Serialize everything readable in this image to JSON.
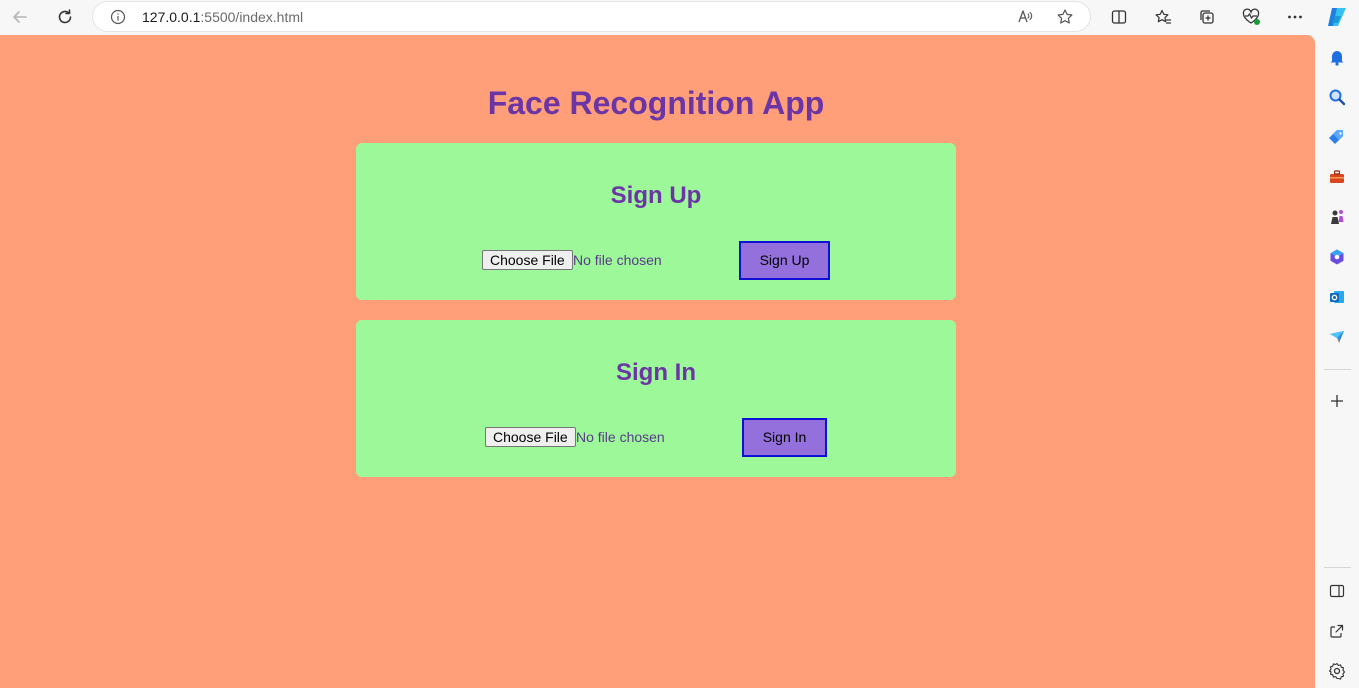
{
  "browser": {
    "url_host": "127.0.0.1",
    "url_rest": ":5500/index.html",
    "toolbar_icons": [
      "back-icon",
      "refresh-icon",
      "site-info-icon",
      "read-aloud-icon",
      "favorite-star-icon",
      "split-screen-icon",
      "favorites-icon",
      "collections-icon",
      "browser-essentials-icon",
      "more-menu-icon",
      "copilot-icon"
    ],
    "sidebar_icons": [
      "notifications-icon",
      "search-icon",
      "shopping-icon",
      "tools-icon",
      "games-icon",
      "microsoft-365-icon",
      "outlook-icon",
      "drop-icon",
      "add-icon",
      "sidebar-toggle-icon",
      "open-external-icon",
      "settings-icon"
    ]
  },
  "colors": {
    "page_background": "#ff9f79",
    "card_background": "#9cf899",
    "title_color": "#6b35a6",
    "button_fill": "#9370db",
    "button_border": "#0f10d6",
    "status_text": "#5a3a8a"
  },
  "page": {
    "title": "Face Recognition App",
    "signup": {
      "heading": "Sign Up",
      "file_button": "Choose File",
      "file_status": "No file chosen",
      "submit": "Sign Up"
    },
    "signin": {
      "heading": "Sign In",
      "file_button": "Choose File",
      "file_status": "No file chosen",
      "submit": "Sign In"
    }
  }
}
